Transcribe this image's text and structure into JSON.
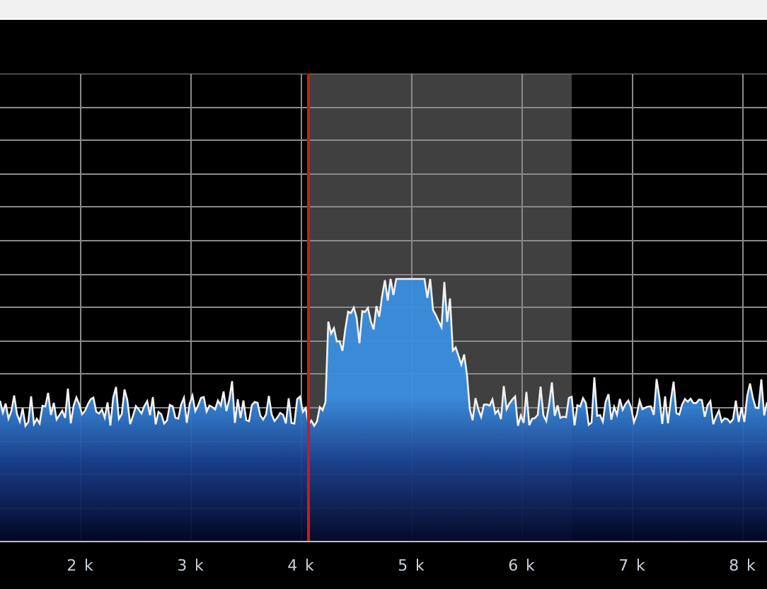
{
  "spectrum": {
    "x_axis_labels": [
      "2 k",
      "3 k",
      "4 k",
      "5 k",
      "6 k",
      "7 k",
      "8 k"
    ]
  }
}
